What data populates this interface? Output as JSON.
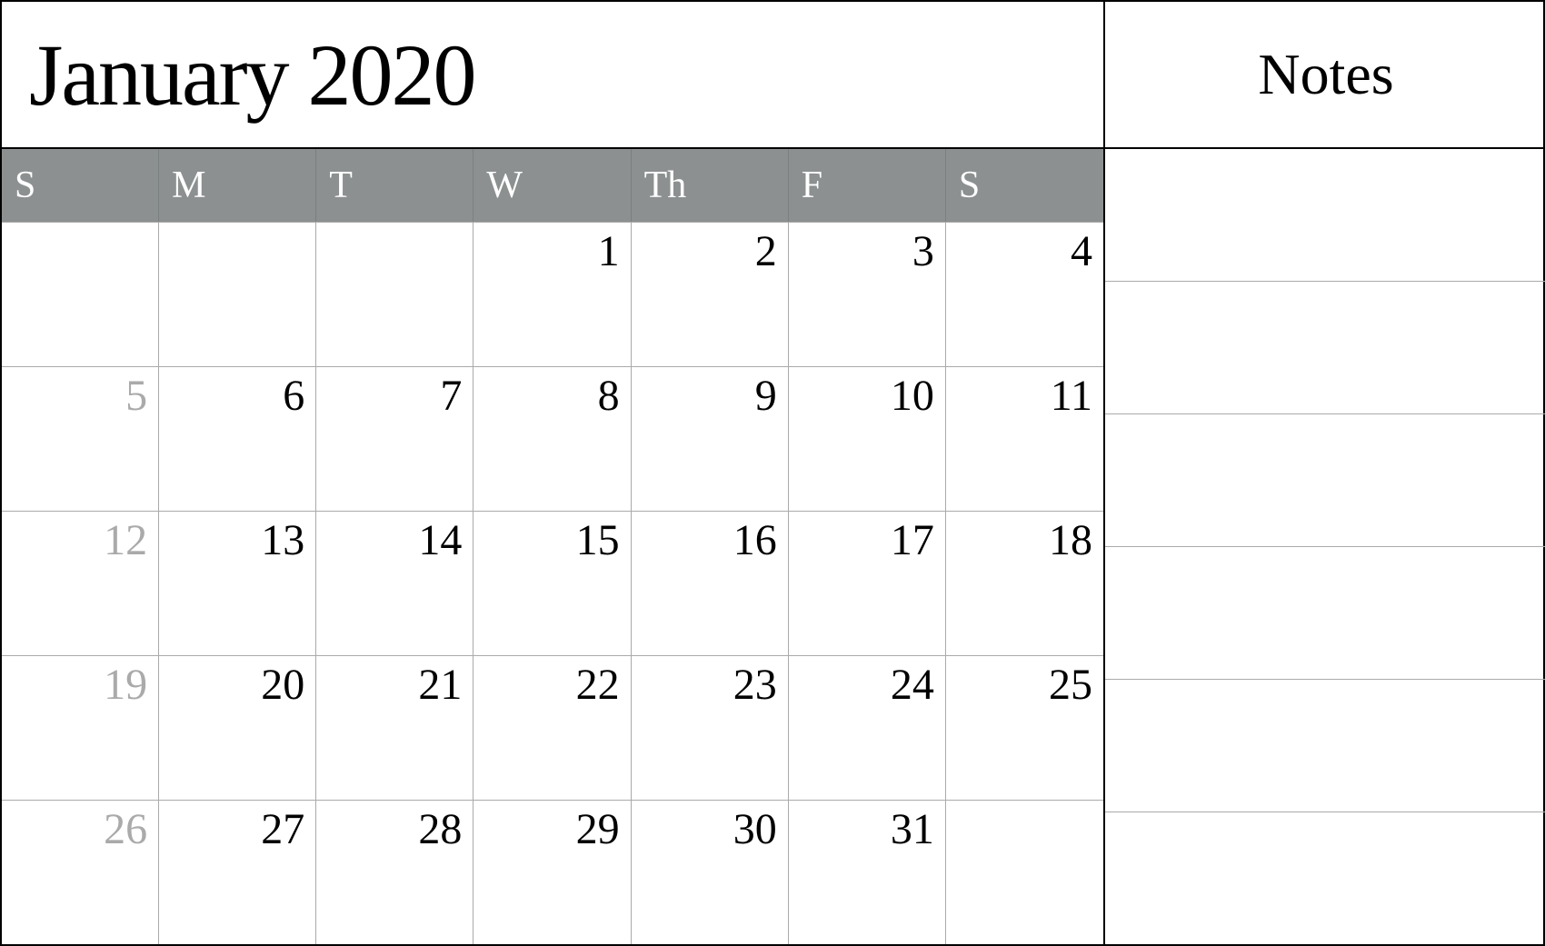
{
  "header": {
    "title": "January 2020",
    "notes_label": "Notes"
  },
  "days_header": [
    "S",
    "M",
    "T",
    "W",
    "Th",
    "F",
    "S"
  ],
  "weeks": [
    [
      {
        "num": "",
        "dimmed": false,
        "empty": true
      },
      {
        "num": "",
        "dimmed": false,
        "empty": true
      },
      {
        "num": "",
        "dimmed": false,
        "empty": true
      },
      {
        "num": "1",
        "dimmed": false,
        "empty": false
      },
      {
        "num": "2",
        "dimmed": false,
        "empty": false
      },
      {
        "num": "3",
        "dimmed": false,
        "empty": false
      },
      {
        "num": "4",
        "dimmed": false,
        "empty": false
      }
    ],
    [
      {
        "num": "5",
        "dimmed": true,
        "empty": false
      },
      {
        "num": "6",
        "dimmed": false,
        "empty": false
      },
      {
        "num": "7",
        "dimmed": false,
        "empty": false
      },
      {
        "num": "8",
        "dimmed": false,
        "empty": false
      },
      {
        "num": "9",
        "dimmed": false,
        "empty": false
      },
      {
        "num": "10",
        "dimmed": false,
        "empty": false
      },
      {
        "num": "11",
        "dimmed": false,
        "empty": false
      }
    ],
    [
      {
        "num": "12",
        "dimmed": true,
        "empty": false
      },
      {
        "num": "13",
        "dimmed": false,
        "empty": false
      },
      {
        "num": "14",
        "dimmed": false,
        "empty": false
      },
      {
        "num": "15",
        "dimmed": false,
        "empty": false
      },
      {
        "num": "16",
        "dimmed": false,
        "empty": false
      },
      {
        "num": "17",
        "dimmed": false,
        "empty": false
      },
      {
        "num": "18",
        "dimmed": false,
        "empty": false
      }
    ],
    [
      {
        "num": "19",
        "dimmed": true,
        "empty": false
      },
      {
        "num": "20",
        "dimmed": false,
        "empty": false
      },
      {
        "num": "21",
        "dimmed": false,
        "empty": false
      },
      {
        "num": "22",
        "dimmed": false,
        "empty": false
      },
      {
        "num": "23",
        "dimmed": false,
        "empty": false
      },
      {
        "num": "24",
        "dimmed": false,
        "empty": false
      },
      {
        "num": "25",
        "dimmed": false,
        "empty": false
      }
    ],
    [
      {
        "num": "26",
        "dimmed": true,
        "empty": false
      },
      {
        "num": "27",
        "dimmed": false,
        "empty": false
      },
      {
        "num": "28",
        "dimmed": false,
        "empty": false
      },
      {
        "num": "29",
        "dimmed": false,
        "empty": false
      },
      {
        "num": "30",
        "dimmed": false,
        "empty": false
      },
      {
        "num": "31",
        "dimmed": false,
        "empty": false
      },
      {
        "num": "",
        "dimmed": false,
        "empty": true
      }
    ]
  ]
}
